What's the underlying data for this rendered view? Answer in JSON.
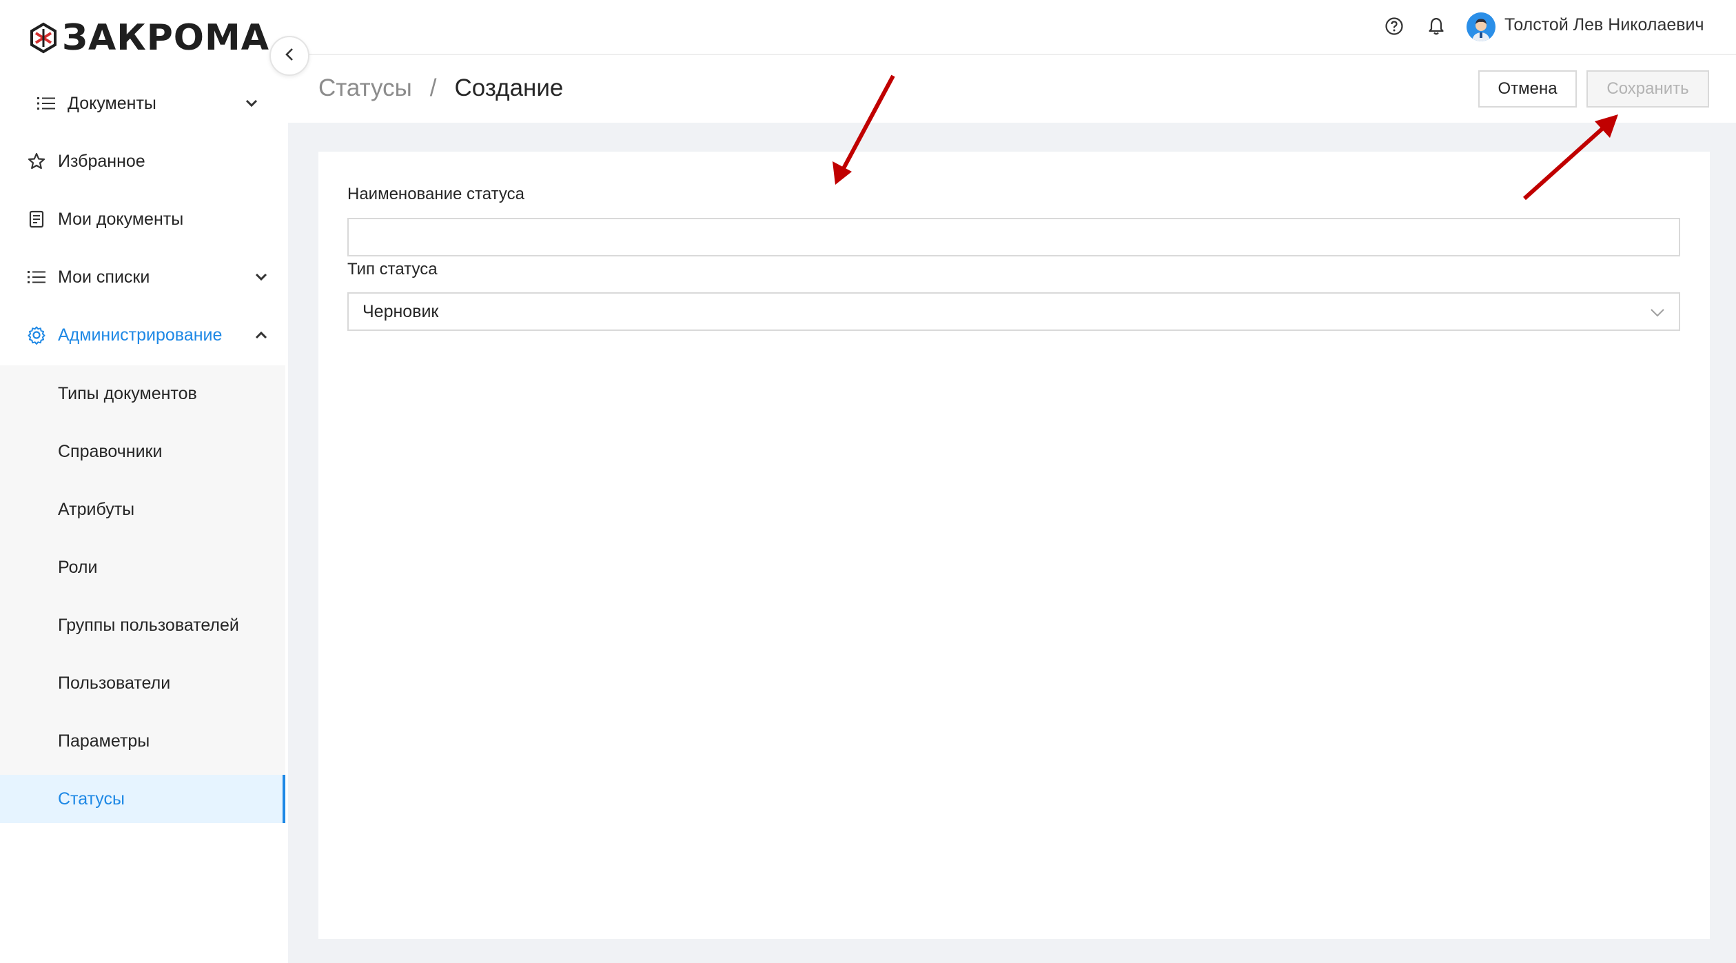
{
  "app": {
    "logo_text": "ЗАКРОМА"
  },
  "header": {
    "help_icon": "question-circle-icon",
    "bell_icon": "bell-icon",
    "user_name": "Толстой Лев Николаевич"
  },
  "sidebar": {
    "items": [
      {
        "label": "Документы",
        "icon": "list-icon",
        "chevron": "down"
      },
      {
        "label": "Избранное",
        "icon": "star-icon"
      },
      {
        "label": "Мои документы",
        "icon": "document-icon"
      },
      {
        "label": "Мои списки",
        "icon": "list-icon",
        "chevron": "down"
      },
      {
        "label": "Администрирование",
        "icon": "gear-icon",
        "chevron": "up",
        "active": true
      }
    ],
    "admin_subitems": [
      {
        "label": "Типы документов"
      },
      {
        "label": "Справочники"
      },
      {
        "label": "Атрибуты"
      },
      {
        "label": "Роли"
      },
      {
        "label": "Группы пользователей"
      },
      {
        "label": "Пользователи"
      },
      {
        "label": "Параметры"
      },
      {
        "label": "Статусы",
        "selected": true
      }
    ]
  },
  "page": {
    "breadcrumb_parent": "Статусы",
    "breadcrumb_separator": "/",
    "breadcrumb_current": "Создание",
    "cancel_label": "Отмена",
    "save_label": "Сохранить",
    "save_disabled": true
  },
  "form": {
    "name_label": "Наименование статуса",
    "name_value": "",
    "type_label": "Тип статуса",
    "type_value": "Черновик"
  },
  "colors": {
    "accent": "#1e88e5",
    "annotation_arrow": "#c00000",
    "content_bg": "#f0f2f5"
  }
}
